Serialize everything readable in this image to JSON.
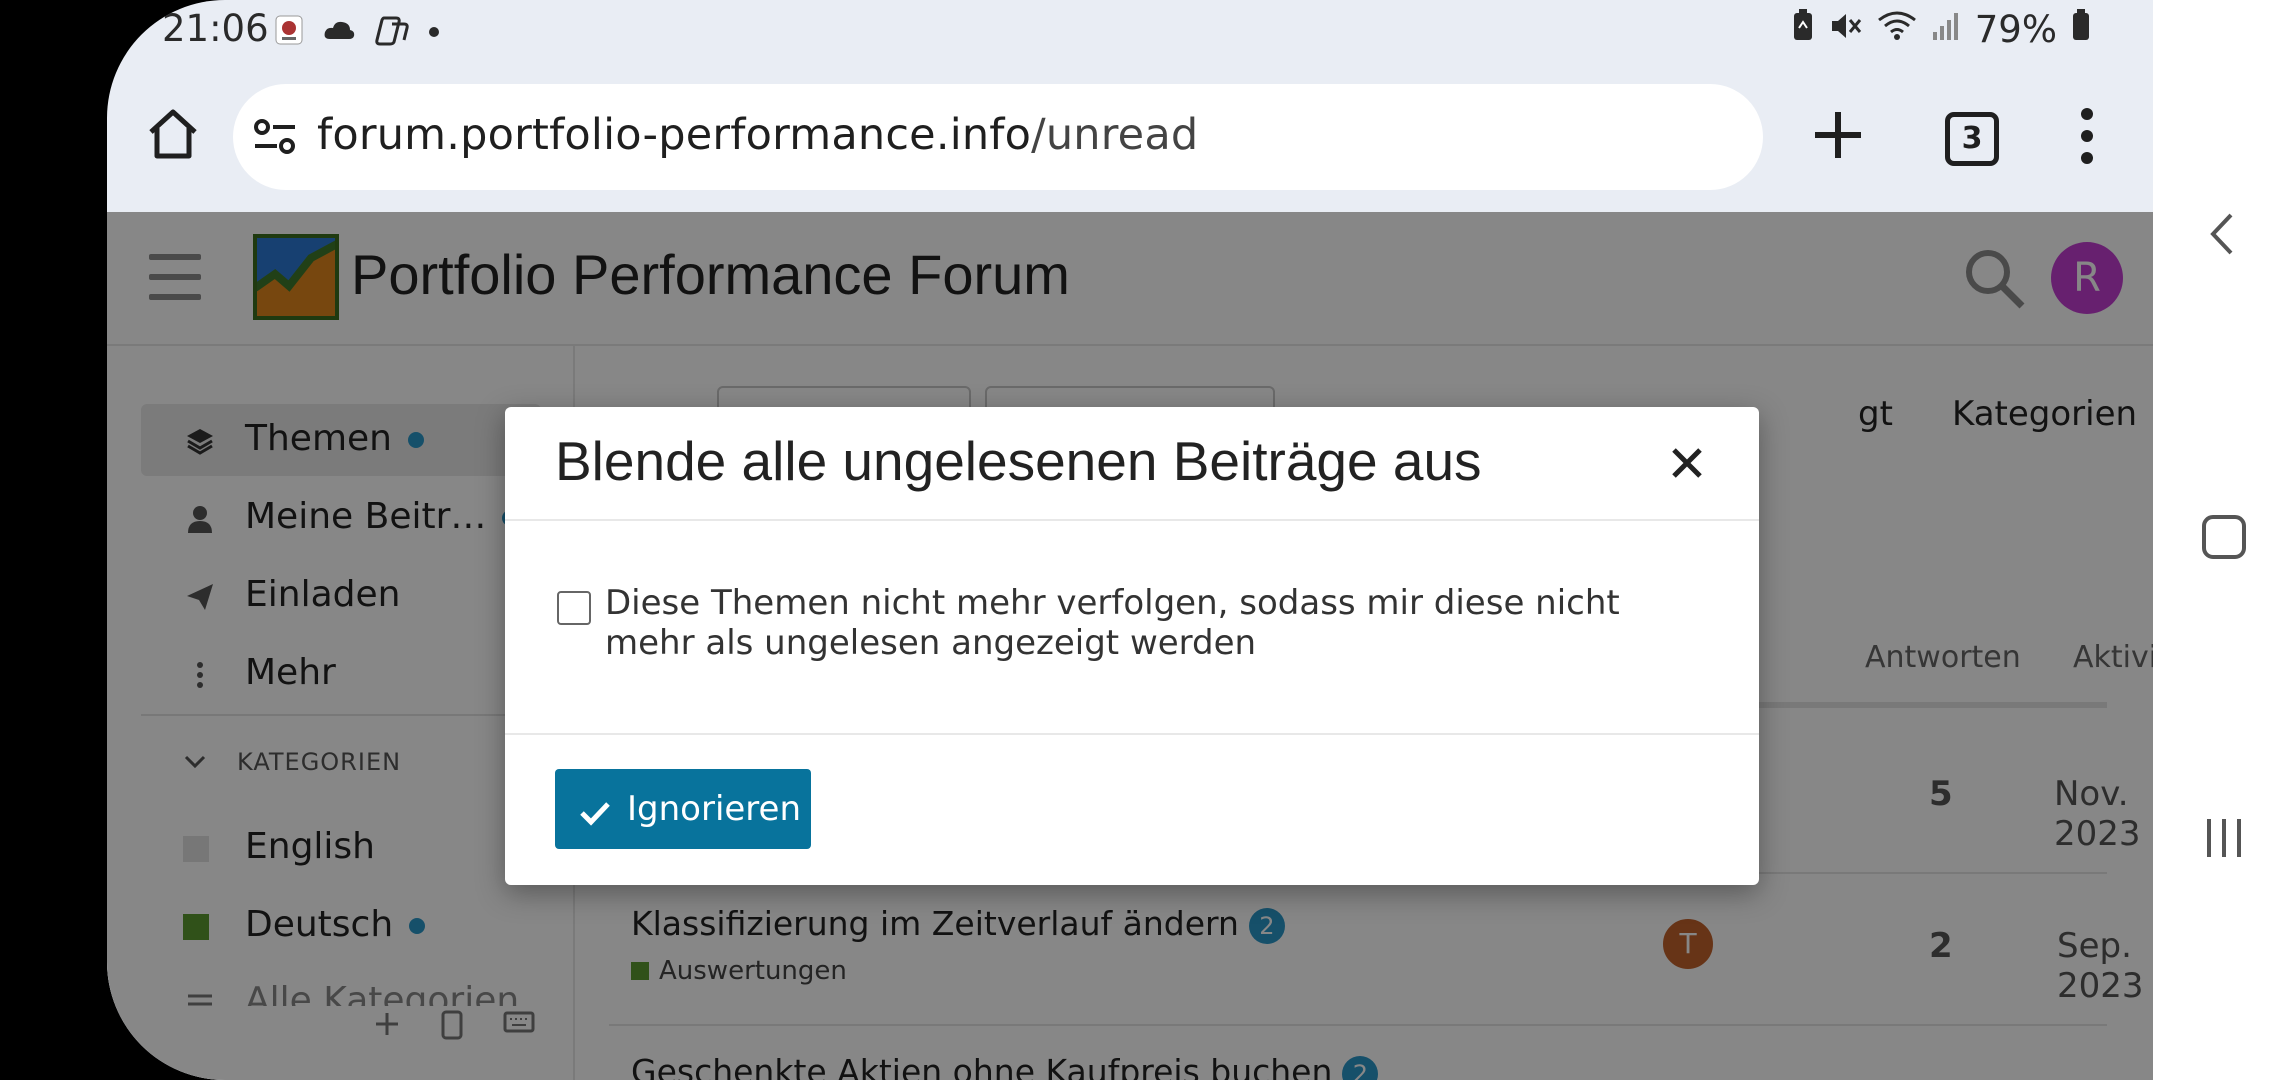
{
  "status_bar": {
    "time": "21:06",
    "battery": "79%",
    "icons": [
      "notification-app-icon",
      "cloud-icon",
      "copilot-icon",
      "dot-icon",
      "battery-saver-icon",
      "mute-icon",
      "wifi-icon",
      "signal-icon",
      "battery-icon"
    ]
  },
  "browser": {
    "url_host": "forum.portfolio-performance.info",
    "url_path": "/unread",
    "tab_count": "3"
  },
  "site": {
    "title": "Portfolio Performance Forum",
    "avatar_letter": "R"
  },
  "sidebar": {
    "items": [
      {
        "label": "Themen",
        "icon": "layers-icon",
        "active": true,
        "dot": true
      },
      {
        "label": "Meine Beitr…",
        "icon": "user-icon",
        "active": false,
        "dot": true
      },
      {
        "label": "Einladen",
        "icon": "paper-plane-icon",
        "active": false,
        "dot": false
      },
      {
        "label": "Mehr",
        "icon": "vertical-dots-icon",
        "active": false,
        "dot": false
      }
    ],
    "categories_heading": "KATEGORIEN",
    "categories": [
      {
        "label": "English",
        "color": "#e0e0e0",
        "dot": false
      },
      {
        "label": "Deutsch",
        "color": "#5b9a30",
        "dot": true
      },
      {
        "label": "Alle Kategorien",
        "color": "#cccccc",
        "dot": false
      }
    ]
  },
  "main": {
    "nav_partial": "gt",
    "nav_categories": "Kategorien",
    "col_replies": "Antworten",
    "col_activity": "Aktivität",
    "topics": [
      {
        "title": "",
        "badge": "",
        "category": "",
        "poster": "",
        "replies": "5",
        "activity": "Nov. 2023"
      },
      {
        "title": "Klassifizierung im Zeitverlauf ändern",
        "badge": "2",
        "category": "Auswertungen",
        "poster": "T",
        "replies": "2",
        "activity": "Sep. 2023"
      },
      {
        "title": "Geschenkte Aktien ohne Kaufpreis buchen",
        "badge": "2",
        "category": "",
        "poster": "",
        "replies": "",
        "activity": ""
      }
    ]
  },
  "modal": {
    "title": "Blende alle ungelesenen Beiträge aus",
    "checkbox_label": "Diese Themen nicht mehr verfolgen, sodass mir diese nicht mehr als ungelesen angezeigt werden",
    "checkbox_checked": false,
    "confirm_label": "Ignorieren"
  },
  "colors": {
    "accent": "#08739c",
    "badge": "#2a97c9",
    "avatar": "#c23ed1"
  }
}
